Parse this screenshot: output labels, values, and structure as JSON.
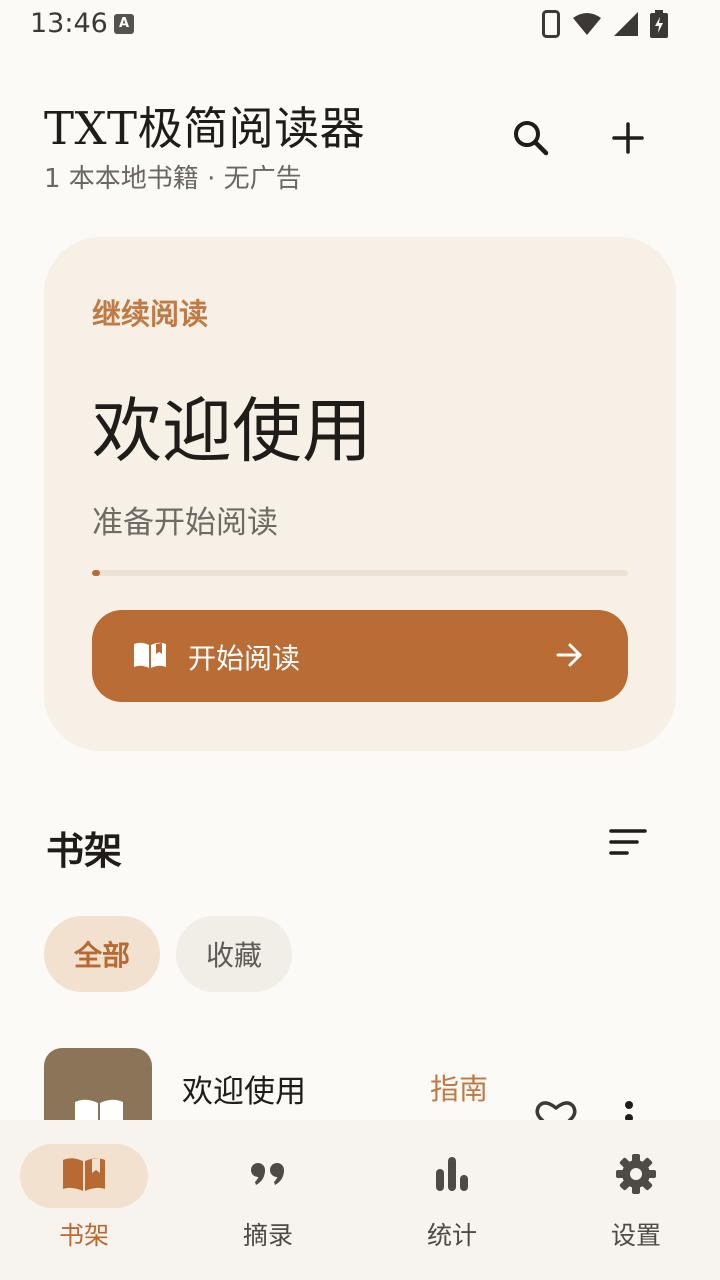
{
  "status_bar": {
    "time": "13:46",
    "notification_badge": "A",
    "icons": [
      "phone-icon",
      "wifi-icon",
      "signal-icon",
      "battery-charging-icon"
    ]
  },
  "header": {
    "title": "TXT极简阅读器",
    "subtitle": "1 本本地书籍 · 无广告",
    "actions": [
      "search-icon",
      "plus-icon"
    ]
  },
  "continue_card": {
    "label": "继续阅读",
    "book_title": "欢迎使用",
    "status_text": "准备开始阅读",
    "progress_fraction": 0.015,
    "button_label": "开始阅读"
  },
  "shelf": {
    "title": "书架",
    "filters": [
      {
        "label": "全部",
        "selected": true
      },
      {
        "label": "收藏",
        "selected": false
      }
    ],
    "books": [
      {
        "title": "欢迎使用",
        "tag": "指南",
        "favorite": false
      }
    ]
  },
  "bottom_nav": {
    "items": [
      {
        "label": "书架",
        "icon": "open-book-icon",
        "active": true
      },
      {
        "label": "摘录",
        "icon": "quote-icon",
        "active": false
      },
      {
        "label": "统计",
        "icon": "bar-chart-icon",
        "active": false
      },
      {
        "label": "设置",
        "icon": "gear-icon",
        "active": false
      }
    ]
  },
  "colors": {
    "accent": "#b96d34",
    "accent_text": "#c07a45",
    "card_background": "#f6f0e6",
    "page_background": "#fcfaf7",
    "selected_chip": "#f3e1cf"
  }
}
